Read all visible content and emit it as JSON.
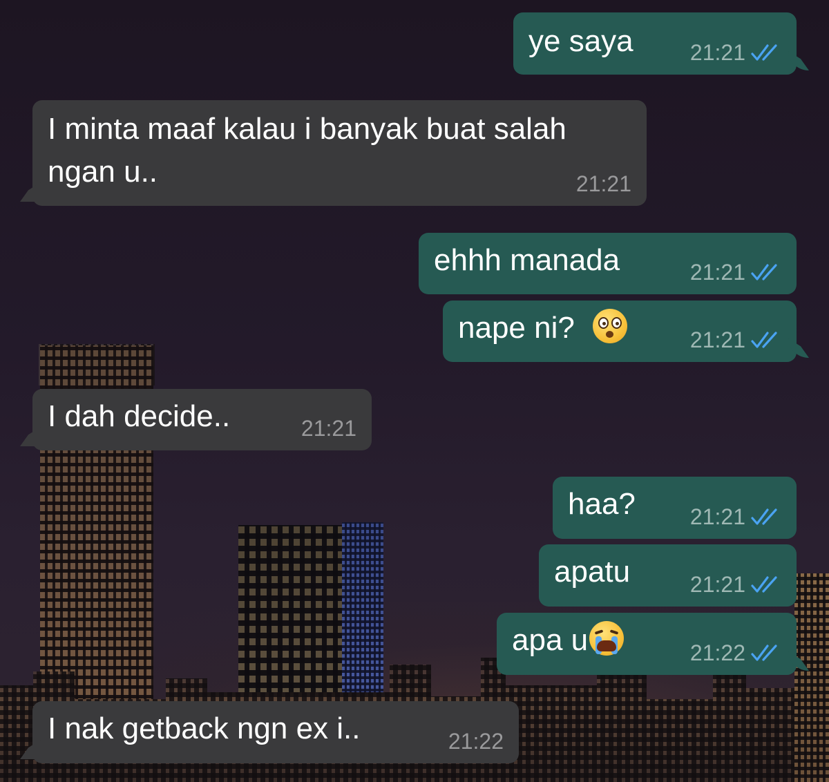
{
  "chat": {
    "messages": [
      {
        "direction": "outgoing",
        "text": "ye saya",
        "time": "21:21",
        "status": "read"
      },
      {
        "direction": "incoming",
        "line1": "I minta maaf kalau i banyak buat salah",
        "line2": "ngan u..",
        "time": "21:21"
      },
      {
        "direction": "outgoing",
        "text": "ehhh manada",
        "time": "21:21",
        "status": "read"
      },
      {
        "direction": "outgoing",
        "text": "nape ni?",
        "emoji": "flushed-face",
        "time": "21:21",
        "status": "read"
      },
      {
        "direction": "incoming",
        "text": "I dah decide..",
        "time": "21:21"
      },
      {
        "direction": "outgoing",
        "text": "haa?",
        "time": "21:21",
        "status": "read"
      },
      {
        "direction": "outgoing",
        "text": "apatu",
        "time": "21:21",
        "status": "read"
      },
      {
        "direction": "outgoing",
        "text": "apa u",
        "emoji": "loudly-crying-face",
        "time": "21:22",
        "status": "read"
      },
      {
        "direction": "incoming",
        "text": "I nak getback ngn ex i..",
        "time": "21:22"
      }
    ]
  },
  "colors": {
    "outgoing_bubble": "#265a53",
    "incoming_bubble": "#3a3a3c",
    "read_checks": "#4aa3f2"
  }
}
